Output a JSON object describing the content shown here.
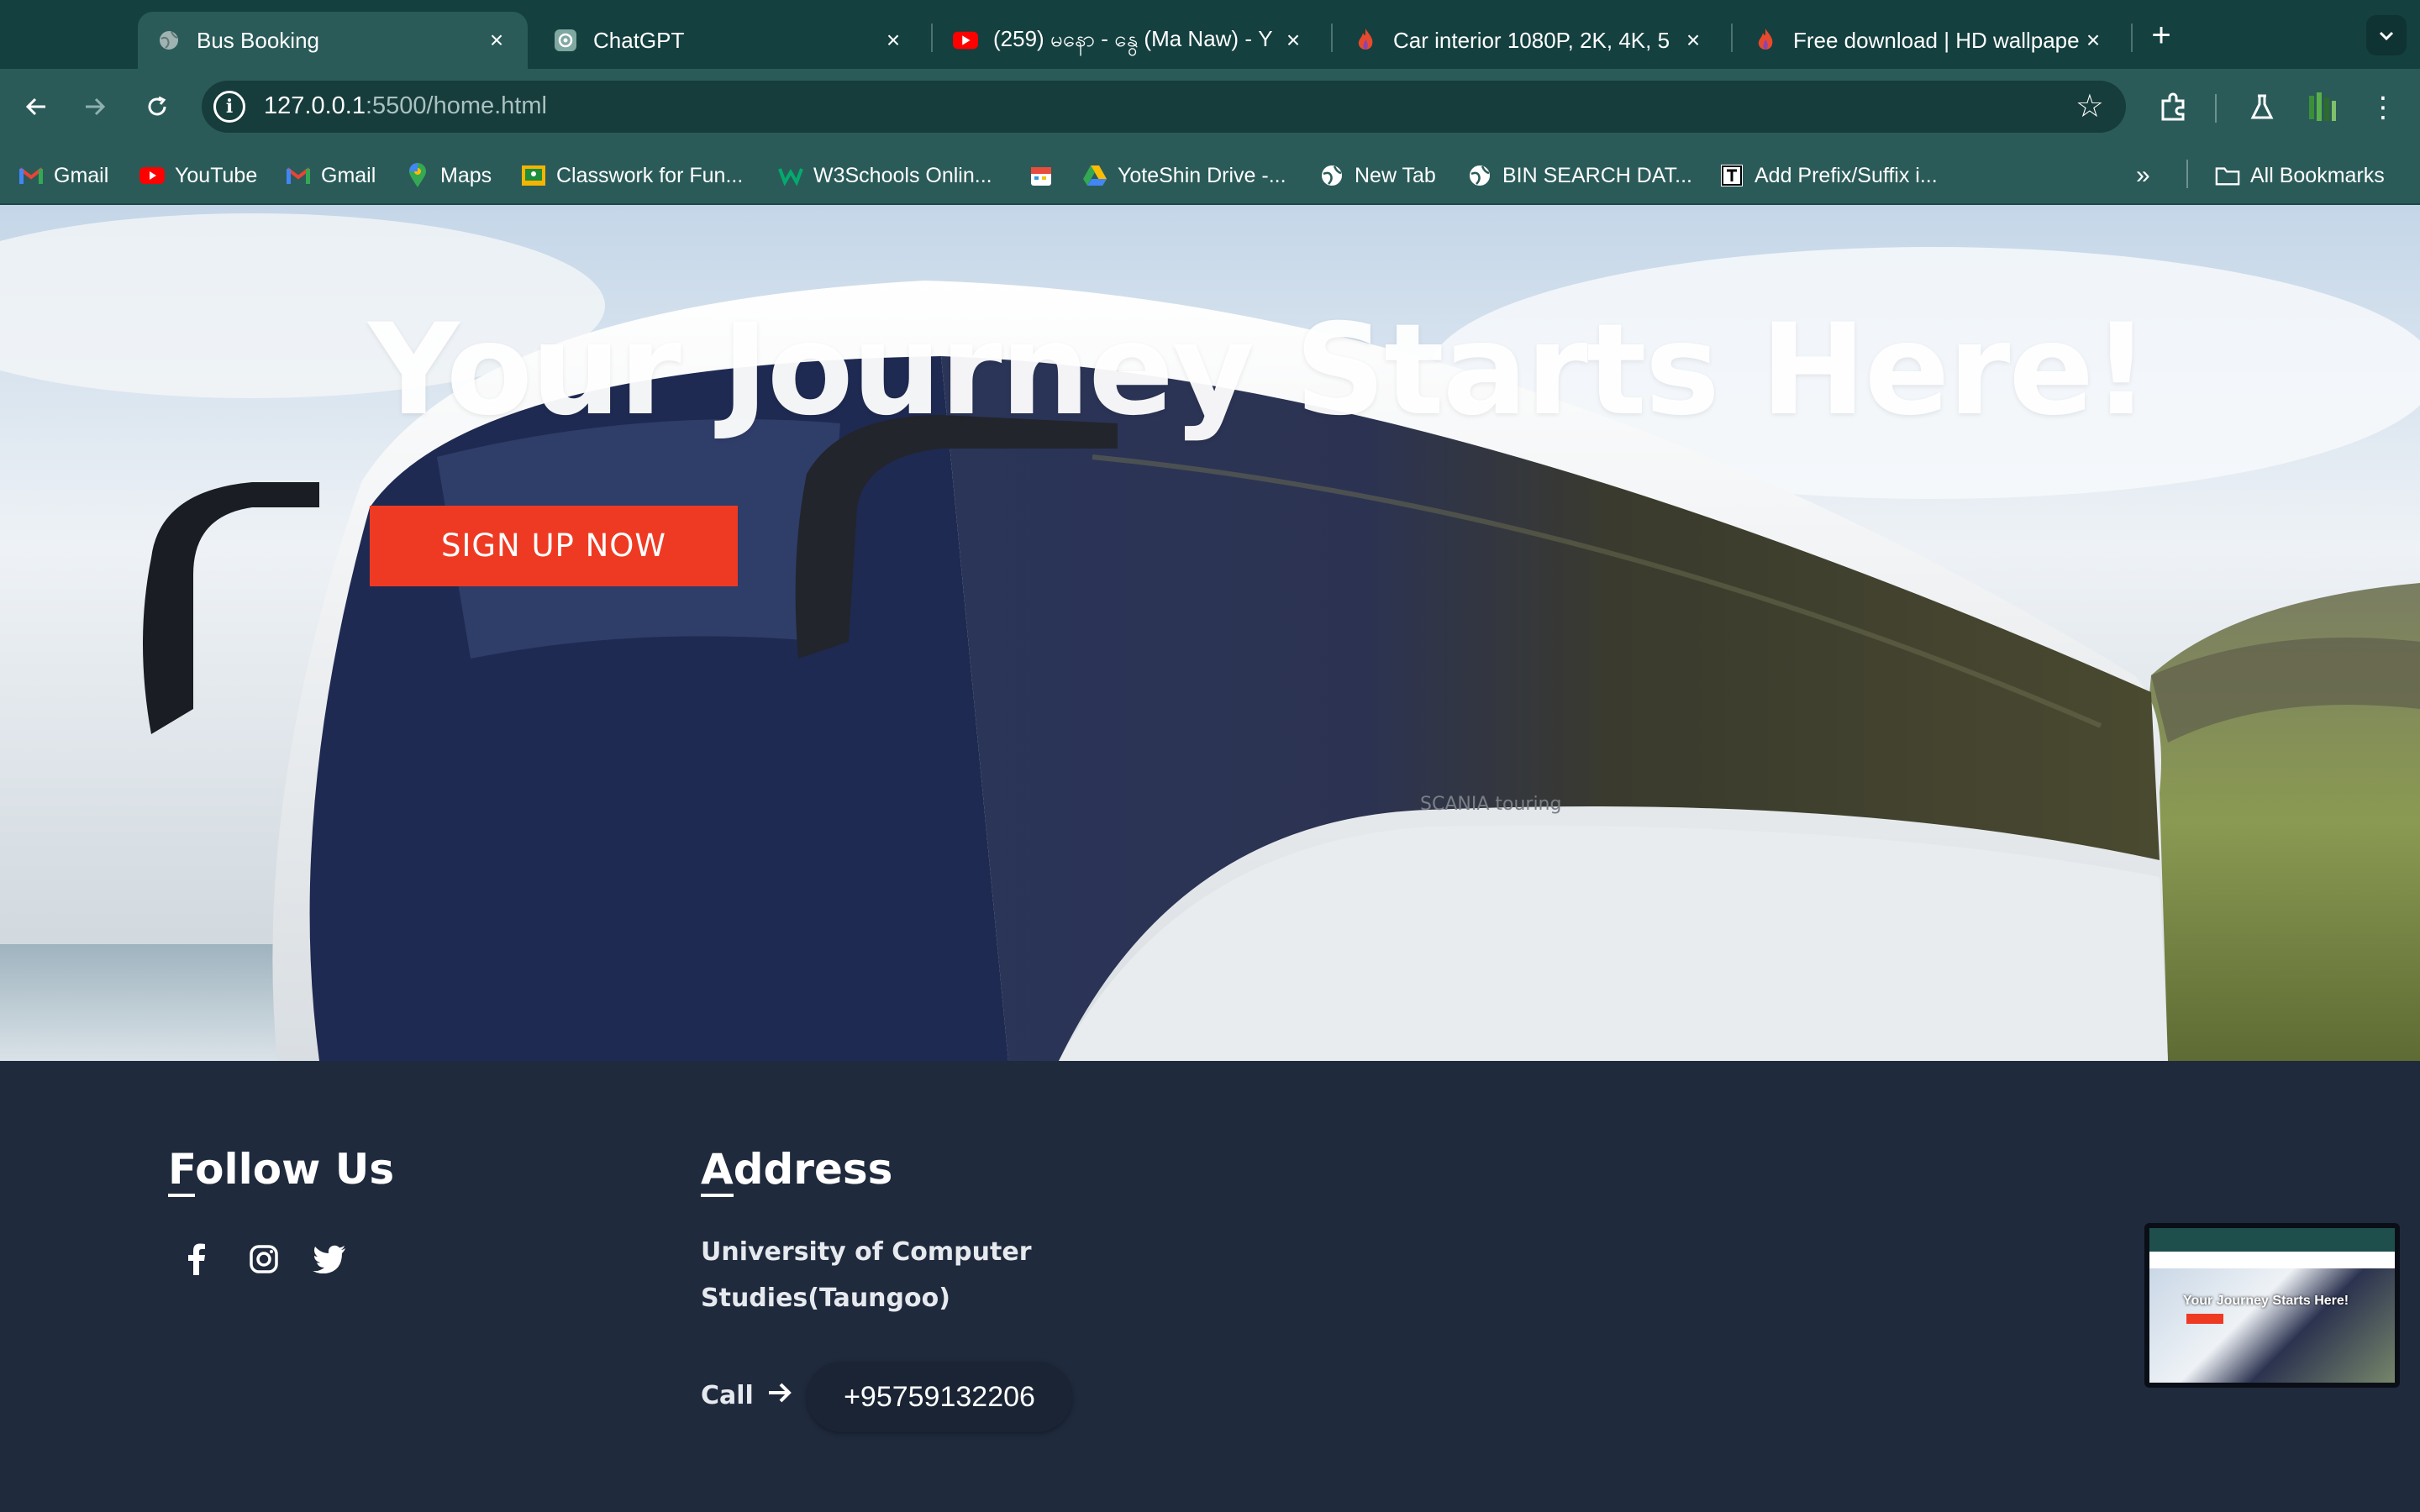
{
  "browser": {
    "tabs": [
      {
        "title": "Bus Booking",
        "icon": "globe-icon",
        "active": true
      },
      {
        "title": "ChatGPT",
        "icon": "chatgpt-icon",
        "active": false
      },
      {
        "title": "(259) မနော - နွေ (Ma Naw) - Y",
        "icon": "youtube-icon",
        "active": false
      },
      {
        "title": "Car interior 1080P, 2K, 4K, 5",
        "icon": "flame-icon",
        "active": false
      },
      {
        "title": "Free download | HD wallpape",
        "icon": "flame-icon",
        "active": false
      }
    ],
    "close_glyph": "×",
    "new_tab_glyph": "+",
    "url_host": "127.0.0.1",
    "url_path": ":5500/home.html",
    "bookmarks": [
      {
        "label": "Gmail",
        "icon": "gmail-icon"
      },
      {
        "label": "YouTube",
        "icon": "youtube-icon"
      },
      {
        "label": "Gmail",
        "icon": "gmail-icon"
      },
      {
        "label": "Maps",
        "icon": "maps-pin-icon"
      },
      {
        "label": "Classwork for Fun...",
        "icon": "classroom-icon"
      },
      {
        "label": "W3Schools Onlin...",
        "icon": "w3schools-icon"
      },
      {
        "label": "",
        "icon": "calendar-icon"
      },
      {
        "label": "YoteShin Drive -...",
        "icon": "drive-icon"
      },
      {
        "label": "New Tab",
        "icon": "globe-icon"
      },
      {
        "label": "BIN SEARCH DAT...",
        "icon": "globe-icon"
      },
      {
        "label": "Add Prefix/Suffix i...",
        "icon": "text-tool-icon"
      }
    ],
    "all_bookmarks_label": "All Bookmarks"
  },
  "page": {
    "hero": {
      "title": "Your Journey Starts Here!",
      "cta_label": "SIGN UP NOW",
      "bus_brand": "SCANIA touring"
    },
    "footer": {
      "follow_heading_first": "F",
      "follow_heading_rest": "ollow Us",
      "social": [
        "facebook-icon",
        "instagram-icon",
        "twitter-icon"
      ],
      "address_heading_first": "A",
      "address_heading_rest": "ddress",
      "address_text": "University of Computer Studies(Taungoo)",
      "call_label": "Call",
      "phone": "+95759132206"
    },
    "thumbnail": {
      "title": "Your Journey Starts Here!"
    }
  },
  "colors": {
    "tabstrip": "#14403f",
    "toolbar": "#2a5b59",
    "cta": "#ee3a23",
    "footer": "#1f2a3d"
  }
}
